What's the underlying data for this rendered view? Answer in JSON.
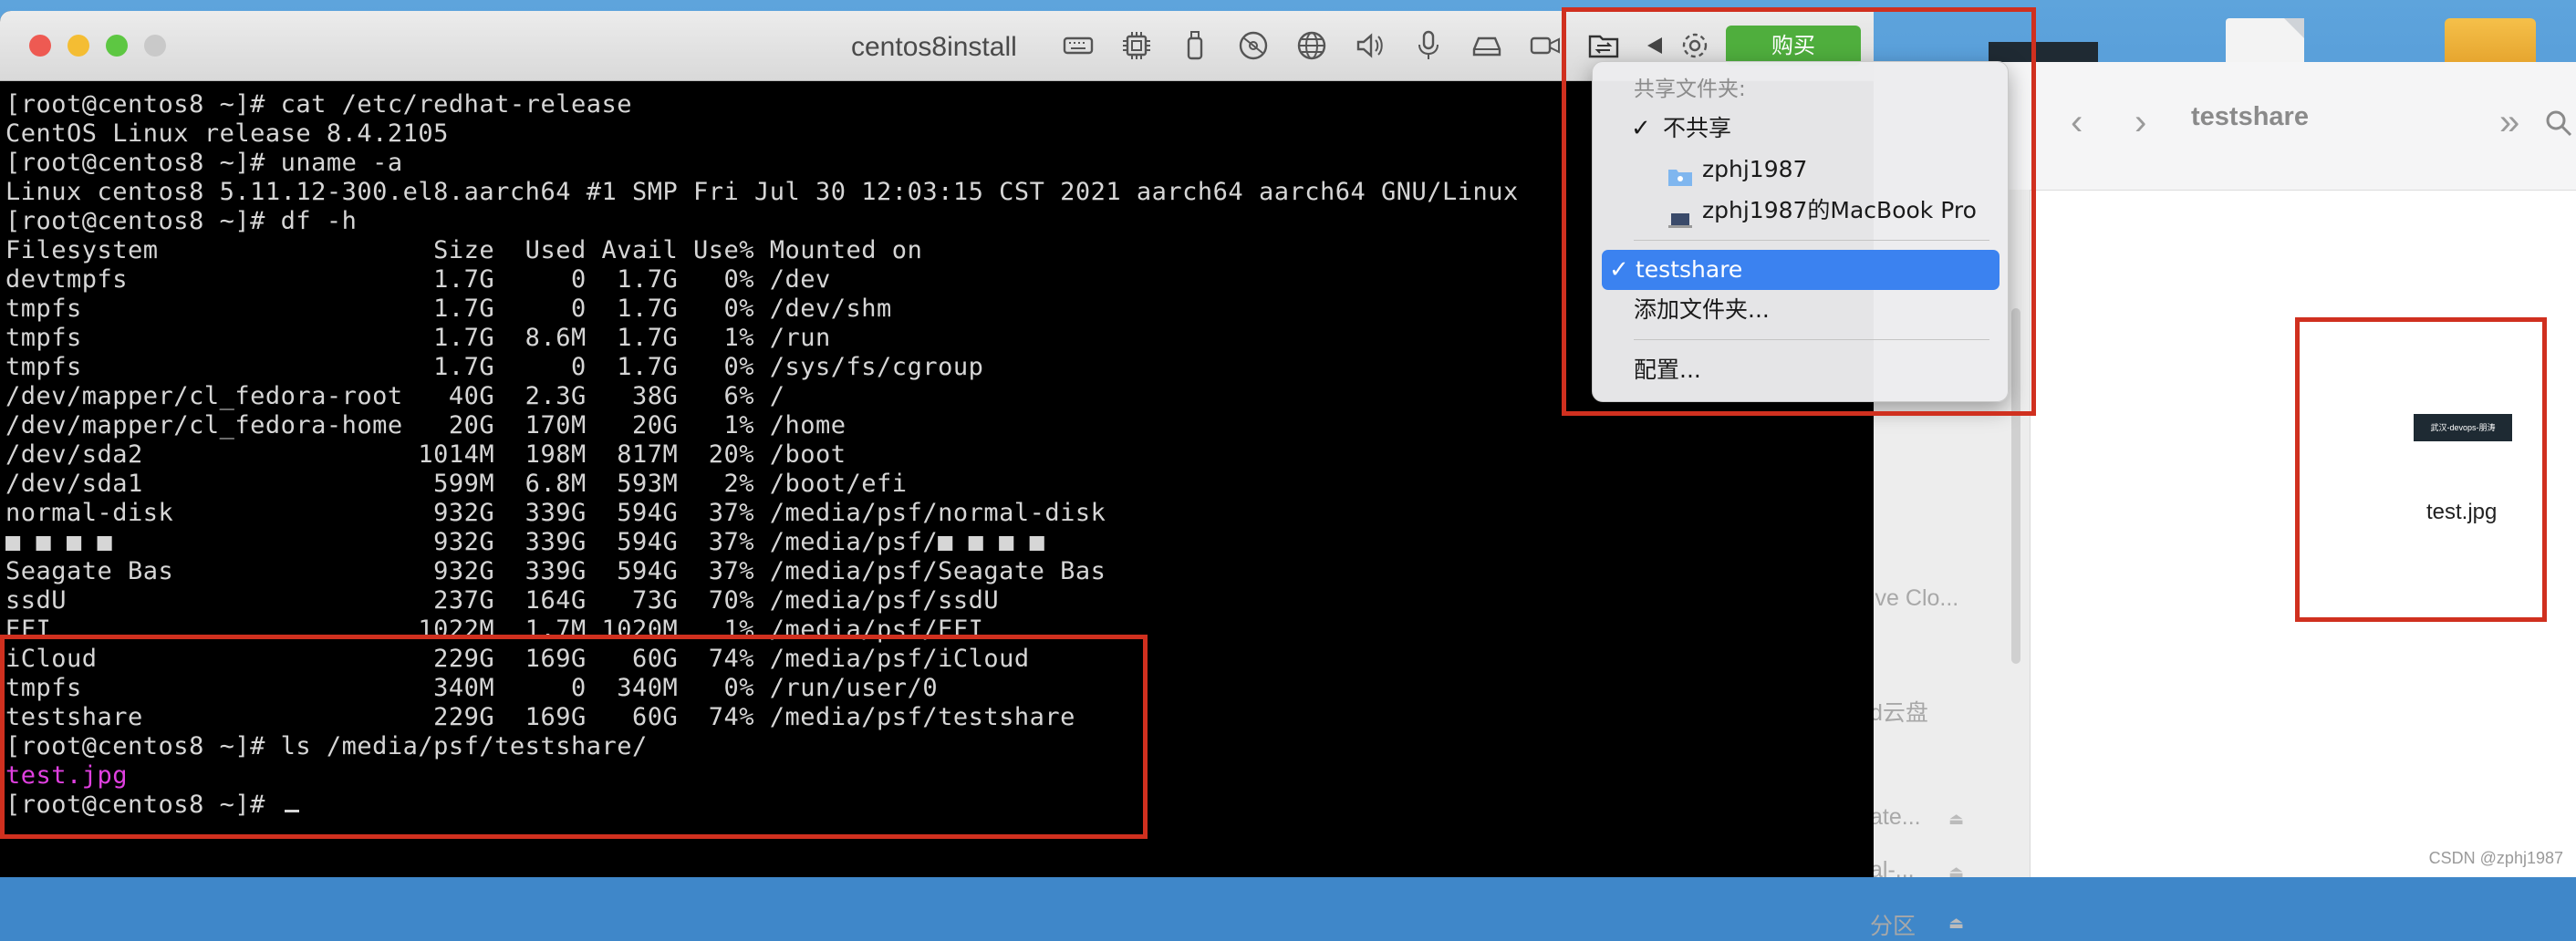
{
  "vm": {
    "title": "centos8install",
    "buy_label": "购买",
    "toolbar_icons": [
      "keyboard-icon",
      "cpu-icon",
      "usb-icon",
      "cd-icon",
      "network-icon",
      "sound-icon",
      "microphone-icon",
      "hard-drive-icon",
      "camera-icon",
      "shared-folder-icon",
      "triangle-left-icon",
      "gear-icon"
    ]
  },
  "terminal": {
    "lines": [
      "[root@centos8 ~]# cat /etc/redhat-release",
      "CentOS Linux release 8.4.2105",
      "[root@centos8 ~]# uname -a",
      "Linux centos8 5.11.12-300.el8.aarch64 #1 SMP Fri Jul 30 12:03:15 CST 2021 aarch64 aarch64 GNU/Linux",
      "[root@centos8 ~]# df -h",
      "Filesystem                  Size  Used Avail Use% Mounted on",
      "devtmpfs                    1.7G     0  1.7G   0% /dev",
      "tmpfs                       1.7G     0  1.7G   0% /dev/shm",
      "tmpfs                       1.7G  8.6M  1.7G   1% /run",
      "tmpfs                       1.7G     0  1.7G   0% /sys/fs/cgroup",
      "/dev/mapper/cl_fedora-root   40G  2.3G   38G   6% /",
      "/dev/mapper/cl_fedora-home   20G  170M   20G   1% /home",
      "/dev/sda2                  1014M  198M  817M  20% /boot",
      "/dev/sda1                   599M  6.8M  593M   2% /boot/efi",
      "normal-disk                 932G  339G  594G  37% /media/psf/normal-disk",
      "■ ■ ■ ■                     932G  339G  594G  37% /media/psf/■ ■ ■ ■",
      "Seagate Bas                 932G  339G  594G  37% /media/psf/Seagate Bas",
      "ssdU                        237G  164G   73G  70% /media/psf/ssdU",
      "EFI                        1022M  1.7M 1020M   1% /media/psf/EFI",
      "iCloud                      229G  169G   60G  74% /media/psf/iCloud",
      "tmpfs                       340M     0  340M   0% /run/user/0",
      "testshare                   229G  169G   60G  74% /media/psf/testshare",
      "[root@centos8 ~]# ls /media/psf/testshare/",
      "test.jpg",
      "[root@centos8 ~]# "
    ]
  },
  "menu": {
    "header": "共享文件夹:",
    "no_share": "不共享",
    "user_folder": "zphj1987",
    "macbook": "zphj1987的MacBook Pro",
    "selected": "testshare",
    "add_folder": "添加文件夹...",
    "configure": "配置..."
  },
  "finder": {
    "title": "testshare",
    "sidebar": [
      "ive Clo...",
      "d云盘",
      "ate...",
      "al-...",
      "分区"
    ],
    "file_name": "test.jpg",
    "thumb_text": "武汉-devops-朋涛"
  },
  "credit": "CSDN @zphj1987",
  "colors": {
    "highlight": "#d0301f",
    "menu_selected": "#3b82f0",
    "buy": "#4fae3d",
    "prompt_pink": "#e040e0"
  }
}
